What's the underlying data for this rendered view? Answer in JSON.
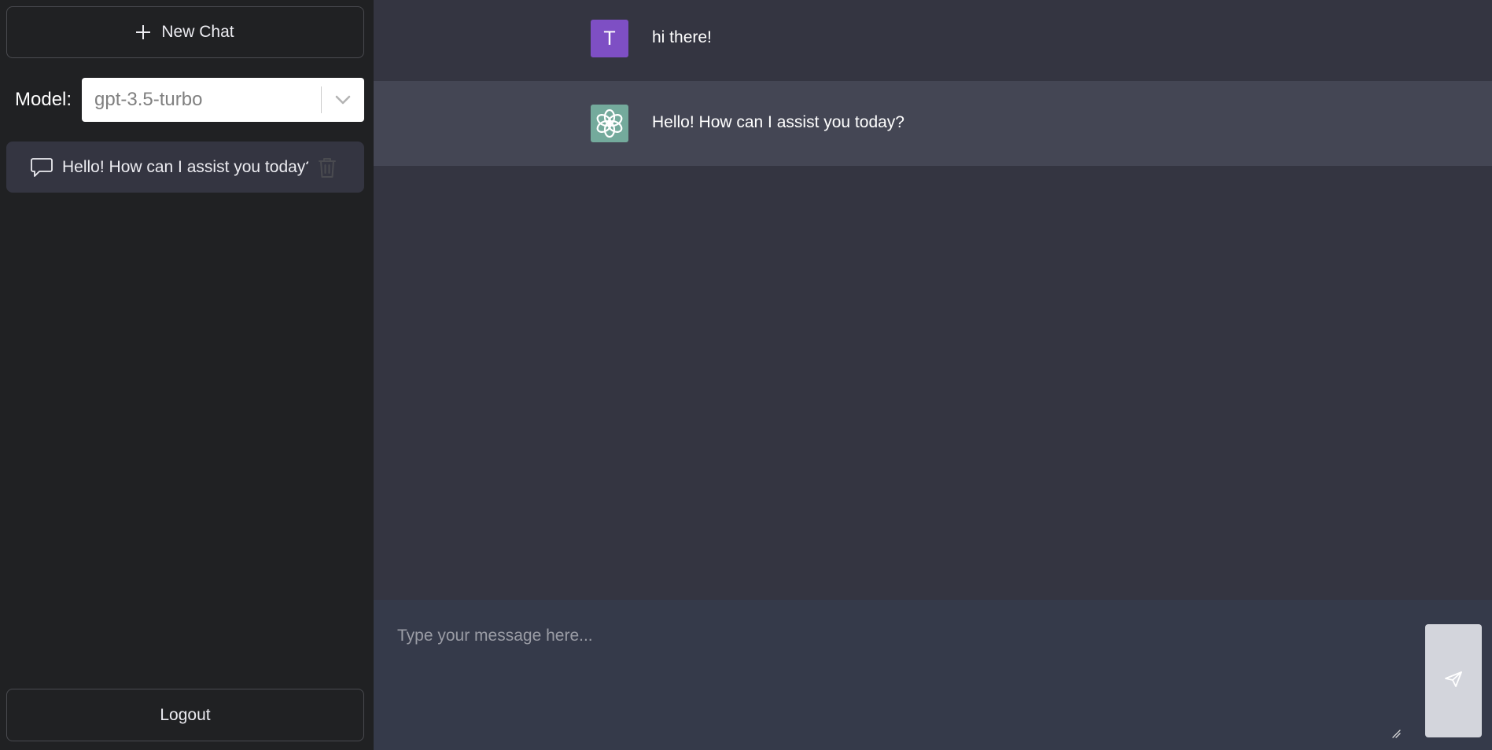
{
  "sidebar": {
    "new_chat_label": "New Chat",
    "model_label": "Model:",
    "model_value": "gpt-3.5-turbo",
    "chats": [
      {
        "title": "Hello! How can I assist you today?"
      }
    ],
    "logout_label": "Logout"
  },
  "conversation": {
    "messages": [
      {
        "role": "user",
        "avatar_letter": "T",
        "text": "hi there!"
      },
      {
        "role": "assistant",
        "avatar_icon": "openai-logo-icon",
        "text": "Hello! How can I assist you today?"
      }
    ]
  },
  "composer": {
    "placeholder": "Type your message here...",
    "send_icon": "send-icon"
  },
  "colors": {
    "sidebar_bg": "#202123",
    "main_bg": "#343541",
    "assistant_row_bg": "#444654",
    "user_avatar_bg": "#7e4fc4",
    "assistant_avatar_bg": "#74aa9c",
    "composer_bg": "#353a4a"
  }
}
